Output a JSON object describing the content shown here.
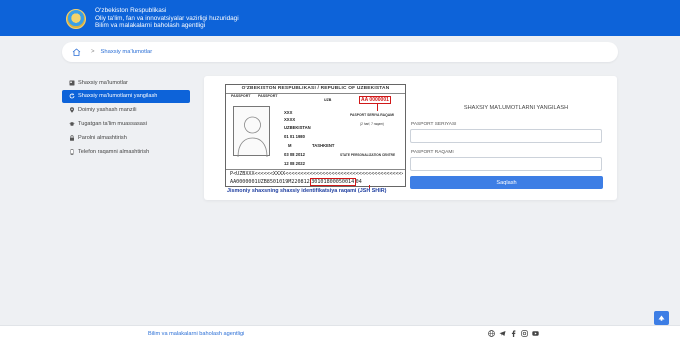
{
  "header": {
    "line1": "O‘zbekiston Respublikasi",
    "line2": "Oliy ta'lim, fan va innovatsiyalar vazirligi huzuridagi",
    "line3": "Bilim va malakalarni baholash agentligi",
    "emblem_icon": "uzbekistan-emblem"
  },
  "breadcrumb": {
    "home_icon": "home-icon",
    "separator": ">",
    "current": "Shaxsiy ma'lumotlar"
  },
  "sidebar": {
    "items": [
      {
        "label": "Shaxsiy ma'lumotlar",
        "icon": "id-card-icon",
        "active": false
      },
      {
        "label": "Shaxsiy ma'lumotlarni yangilash",
        "icon": "refresh-icon",
        "active": true
      },
      {
        "label": "Doimiy yashash manzili",
        "icon": "location-pin-icon",
        "active": false
      },
      {
        "label": "Tugatgan ta'lim muassasasi",
        "icon": "graduation-cap-icon",
        "active": false
      },
      {
        "label": "Parolni almashtirish",
        "icon": "lock-icon",
        "active": false
      },
      {
        "label": "Telefon raqamni almashtirish",
        "icon": "phone-icon",
        "active": false
      }
    ]
  },
  "passport": {
    "title": "O'ZBEKISTON RESPUBLIKASI / REPUBLIC OF UZBEKISTAN",
    "type": "PASSPORT",
    "type2": "PASSPORT",
    "code": "UZB",
    "number": "AA 0000001",
    "surname": "XXX",
    "given_name": "XXXX",
    "nationality": "UZBEKISTAN",
    "dob": "01 01 1980",
    "sex": "M",
    "place_of_birth": "TASHKENT",
    "issue_date": "03 08 2012",
    "expiry_date": "12 08 2022",
    "authority": "STATE PERSONALIZATION CENTRE",
    "series_label": "PASPORT SERIYA RAQAMI",
    "series_hint": "(2 harf, 7 raqam)",
    "mrz1": "P<UZBXXX<<<<<<XXXX<<<<<<<<<<<<<<<<<<<<<<<<<<<<<<<<<<<<<<<<<<<<<<<<<",
    "mrz2_before": "AA0000001UZB8501019M220812",
    "mrz2_highlight": "30101800050014",
    "mrz2_after": "04",
    "caption": "Jismoniy shaxsning shaxsiy identifikatsiya raqami (JSH SHIR)"
  },
  "form": {
    "title": "SHAXSIY MA'LUMOTLARNI YANGILASH",
    "series_label": "PASPORT SERIYASI",
    "series_placeholder": "",
    "number_label": "PASPORT RAQAMI",
    "number_placeholder": "",
    "button": "Saqlash"
  },
  "footer": {
    "text": "Bilim va malakalarni baholash agentligi",
    "social_icons": [
      "globe-icon",
      "telegram-icon",
      "facebook-icon",
      "instagram-icon",
      "youtube-icon"
    ]
  },
  "colors": {
    "header": "#0d63d9",
    "accent": "#3d7ee5",
    "highlight_red": "#d01818"
  }
}
